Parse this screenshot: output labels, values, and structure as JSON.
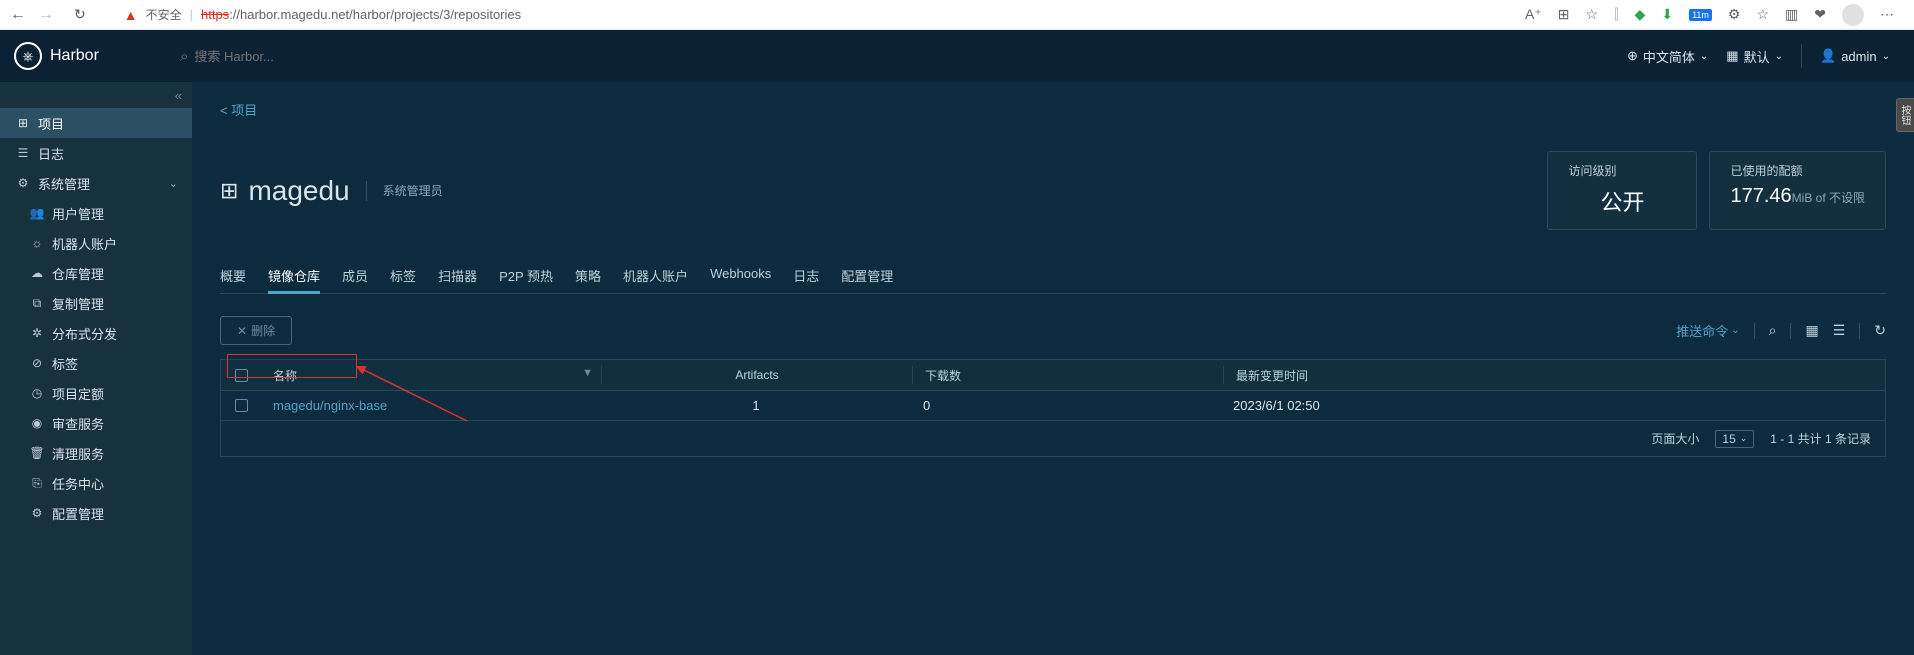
{
  "browser": {
    "insecure": "不安全",
    "url_https": "https",
    "url_path": "://harbor.magedu.net/harbor/projects/3/repositories",
    "badge": "11m"
  },
  "header": {
    "logo": "Harbor",
    "search_placeholder": "搜索 Harbor...",
    "lang": "中文简体",
    "theme": "默认",
    "user": "admin"
  },
  "sidebar": {
    "items": [
      {
        "label": "项目"
      },
      {
        "label": "日志"
      },
      {
        "label": "系统管理"
      },
      {
        "label": "用户管理"
      },
      {
        "label": "机器人账户"
      },
      {
        "label": "仓库管理"
      },
      {
        "label": "复制管理"
      },
      {
        "label": "分布式分发"
      },
      {
        "label": "标签"
      },
      {
        "label": "项目定额"
      },
      {
        "label": "审查服务"
      },
      {
        "label": "清理服务"
      },
      {
        "label": "任务中心"
      },
      {
        "label": "配置管理"
      }
    ]
  },
  "breadcrumb": "项目",
  "project": {
    "name": "magedu",
    "role": "系统管理员"
  },
  "cards": {
    "access_label": "访问级别",
    "access_value": "公开",
    "quota_label": "已使用的配额",
    "quota_value": "177.46",
    "quota_unit": "MiB of 不设限"
  },
  "tabs": [
    "概要",
    "镜像仓库",
    "成员",
    "标签",
    "扫描器",
    "P2P 预热",
    "策略",
    "机器人账户",
    "Webhooks",
    "日志",
    "配置管理"
  ],
  "toolbar": {
    "delete": "删除",
    "push_cmd": "推送命令"
  },
  "table": {
    "headers": {
      "name": "名称",
      "artifacts": "Artifacts",
      "downloads": "下载数",
      "time": "最新变更时间"
    },
    "rows": [
      {
        "name": "magedu/nginx-base",
        "artifacts": "1",
        "downloads": "0",
        "time": "2023/6/1 02:50"
      }
    ]
  },
  "pagination": {
    "page_size_label": "页面大小",
    "page_size": "15",
    "summary": "1 - 1 共计 1 条记录"
  }
}
